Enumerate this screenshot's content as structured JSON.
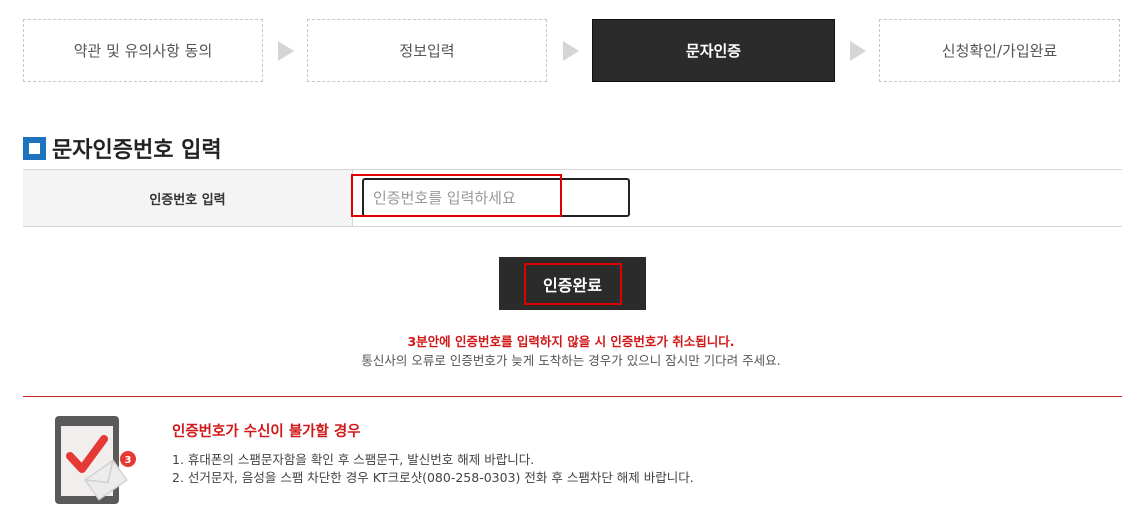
{
  "steps": [
    {
      "label": "약관 및 유의사항 동의",
      "active": false
    },
    {
      "label": "정보입력",
      "active": false
    },
    {
      "label": "문자인증",
      "active": true
    },
    {
      "label": "신청확인/가입완료",
      "active": false
    }
  ],
  "section": {
    "title": "문자인증번호 입력"
  },
  "form": {
    "label": "인증번호 입력",
    "input_placeholder": "인증번호를 입력하세요",
    "input_value": ""
  },
  "button": {
    "label": "인증완료"
  },
  "notices": {
    "red": "3분안에 인증번호를 입력하지 않을 시 인증번호가 취소됩니다.",
    "gray": "통신사의 오류로 인증번호가 늦게 도착하는 경우가 있으니 잠시만 기다려 주세요."
  },
  "help": {
    "title": "인증번호가 수신이 불가할 경우",
    "badge": "3",
    "items": [
      "1. 휴대폰의 스팸문자함을 확인 후 스팸문구, 발신번호 해제 바랍니다.",
      "2. 선거문자, 음성을 스팸 차단한 경우 KT크로샷(080-258-0303) 전화 후 스팸차단 해제 바랍니다."
    ],
    "icon": "phone-check-icon"
  },
  "colors": {
    "active_step": "#2b2b2b",
    "accent_red": "#d01818",
    "highlight_box": "#e00000",
    "section_icon": "#1e73be"
  }
}
